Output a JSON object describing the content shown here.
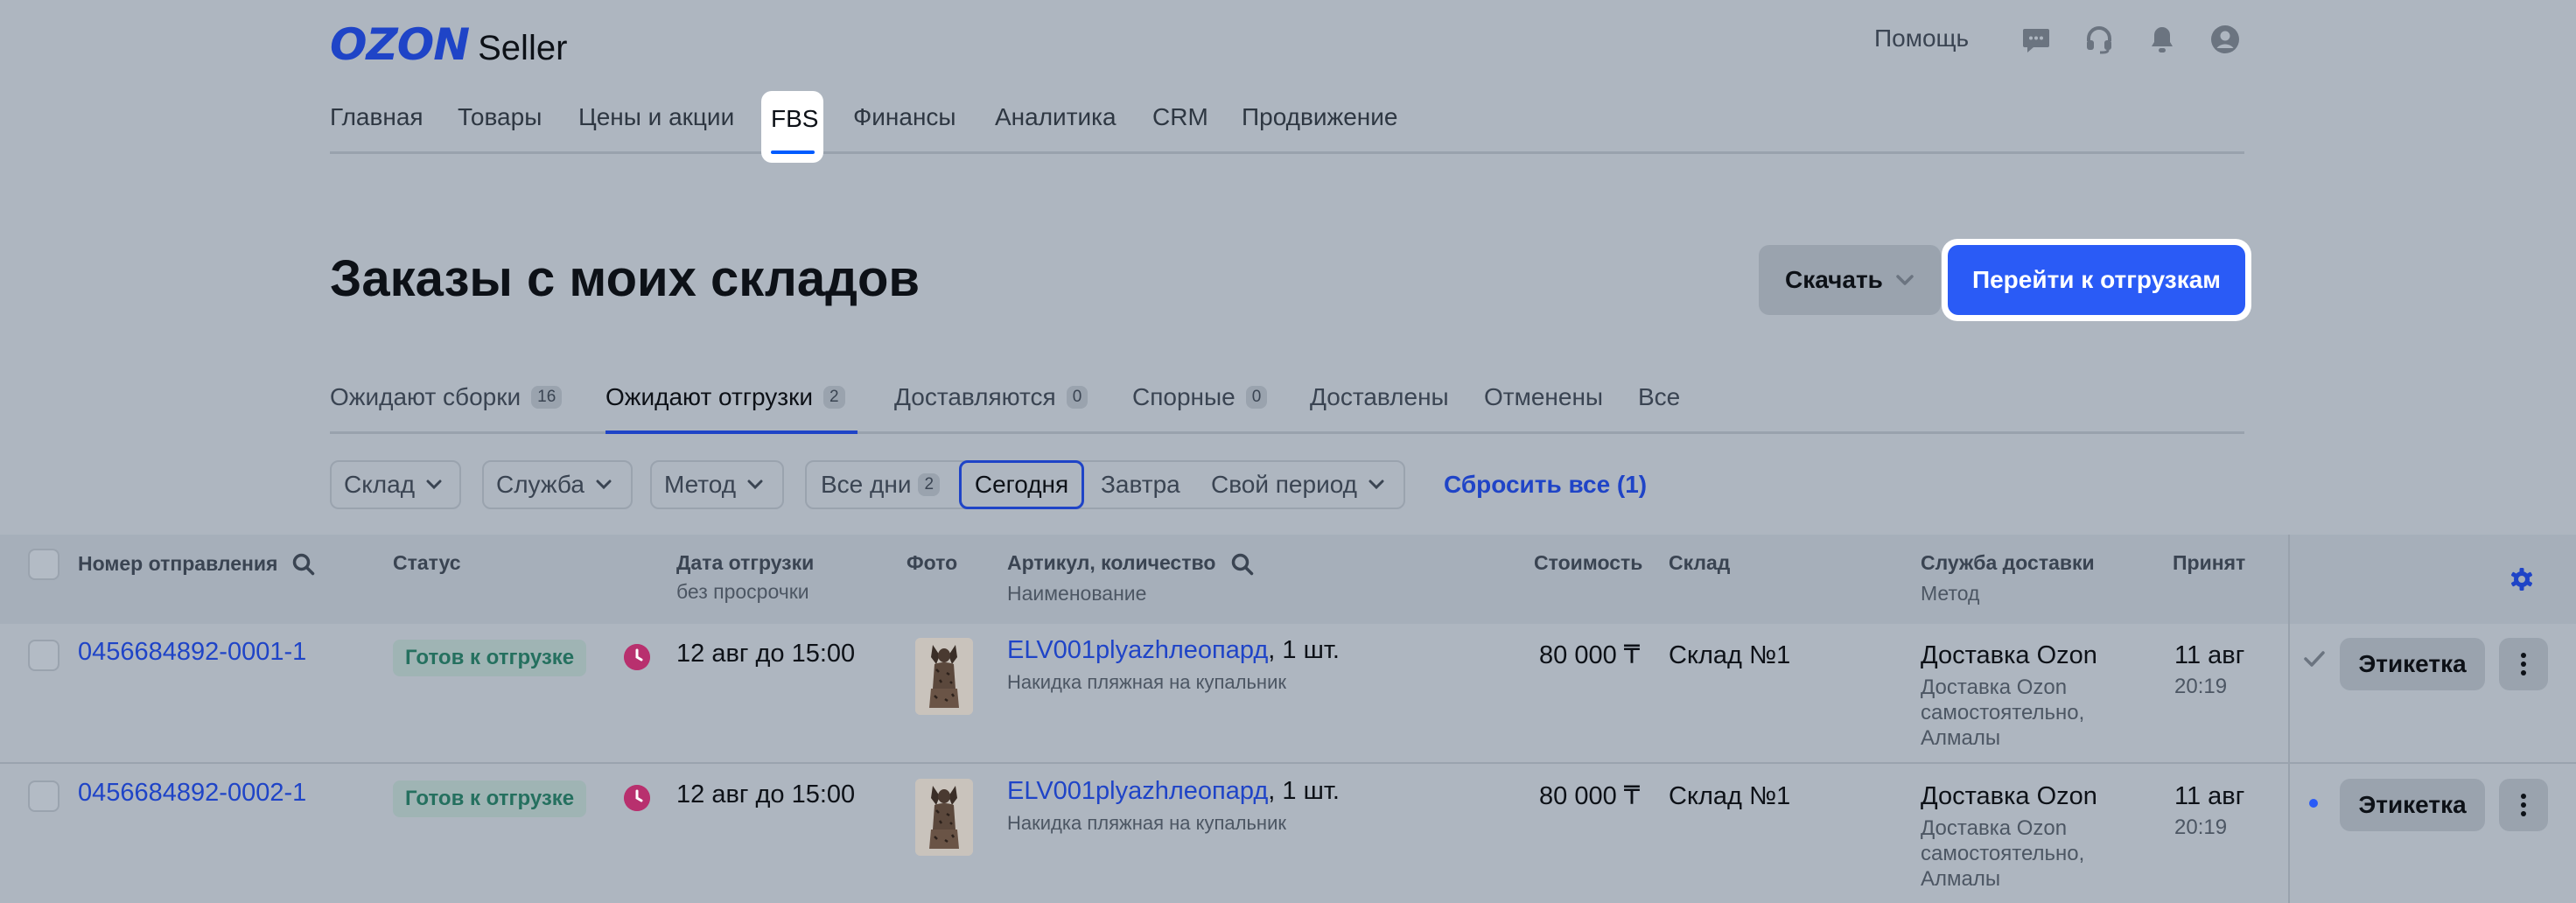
{
  "header": {
    "logo_brand": "OZON",
    "logo_product": "Seller",
    "help_label": "Помощь",
    "icons": [
      "chat-icon",
      "headset-icon",
      "bell-icon",
      "profile-icon"
    ]
  },
  "nav": {
    "items": [
      "Главная",
      "Товары",
      "Цены и акции",
      "FBS",
      "Финансы",
      "Аналитика",
      "CRM",
      "Продвижение"
    ],
    "active": "FBS"
  },
  "page": {
    "title": "Заказы с моих складов",
    "download_label": "Скачать",
    "goto_label": "Перейти к отгрузкам"
  },
  "tabs": [
    {
      "label": "Ожидают сборки",
      "count": "16"
    },
    {
      "label": "Ожидают отгрузки",
      "count": "2",
      "active": true
    },
    {
      "label": "Доставляются",
      "count": "0"
    },
    {
      "label": "Спорные",
      "count": "0"
    },
    {
      "label": "Доставлены"
    },
    {
      "label": "Отменены"
    },
    {
      "label": "Все"
    }
  ],
  "filters": {
    "warehouse": "Склад",
    "service": "Служба",
    "method": "Метод",
    "all_days": "Все дни",
    "all_days_count": "2",
    "today": "Сегодня",
    "tomorrow": "Завтра",
    "custom_period": "Свой период",
    "reset": "Сбросить все (1)"
  },
  "table": {
    "headers": {
      "shipment_number": "Номер отправления",
      "status": "Статус",
      "ship_date": "Дата отгрузки",
      "ship_date_sub": "без просрочки",
      "photo": "Фото",
      "article": "Артикул, количество",
      "article_sub": "Наименование",
      "cost": "Стоимость",
      "warehouse": "Склад",
      "delivery": "Служба доставки",
      "delivery_sub": "Метод",
      "accepted": "Принят"
    },
    "rows": [
      {
        "number": "0456684892-0001-1",
        "status": "Готов к отгрузке",
        "date": "12 авг до 15:00",
        "article": "ELV001plyazhлеопард",
        "qty": ", 1 шт.",
        "name": "Накидка пляжная на купальник",
        "cost": "80 000 ₸",
        "warehouse": "Склад №1",
        "delivery": "Доставка Ozon",
        "method": "Доставка Ozon самостоятельно, Алмалы",
        "accepted_date": "11 авг",
        "accepted_time": "20:19",
        "label_btn": "Этикетка",
        "mark": "check"
      },
      {
        "number": "0456684892-0002-1",
        "status": "Готов к отгрузке",
        "date": "12 авг до 15:00",
        "article": "ELV001plyazhлеопард",
        "qty": ", 1 шт.",
        "name": "Накидка пляжная на купальник",
        "cost": "80 000 ₸",
        "warehouse": "Склад №1",
        "delivery": "Доставка Ozon",
        "method": "Доставка Ozon самостоятельно, Алмалы",
        "accepted_date": "11 авг",
        "accepted_time": "20:19",
        "label_btn": "Этикетка",
        "mark": "dot"
      }
    ]
  },
  "colors": {
    "accent": "#2a5bf6",
    "link": "#1f44c7",
    "status_badge_bg": "#9fb4b4",
    "status_badge_text": "#25705f",
    "clock": "#b8306e"
  }
}
